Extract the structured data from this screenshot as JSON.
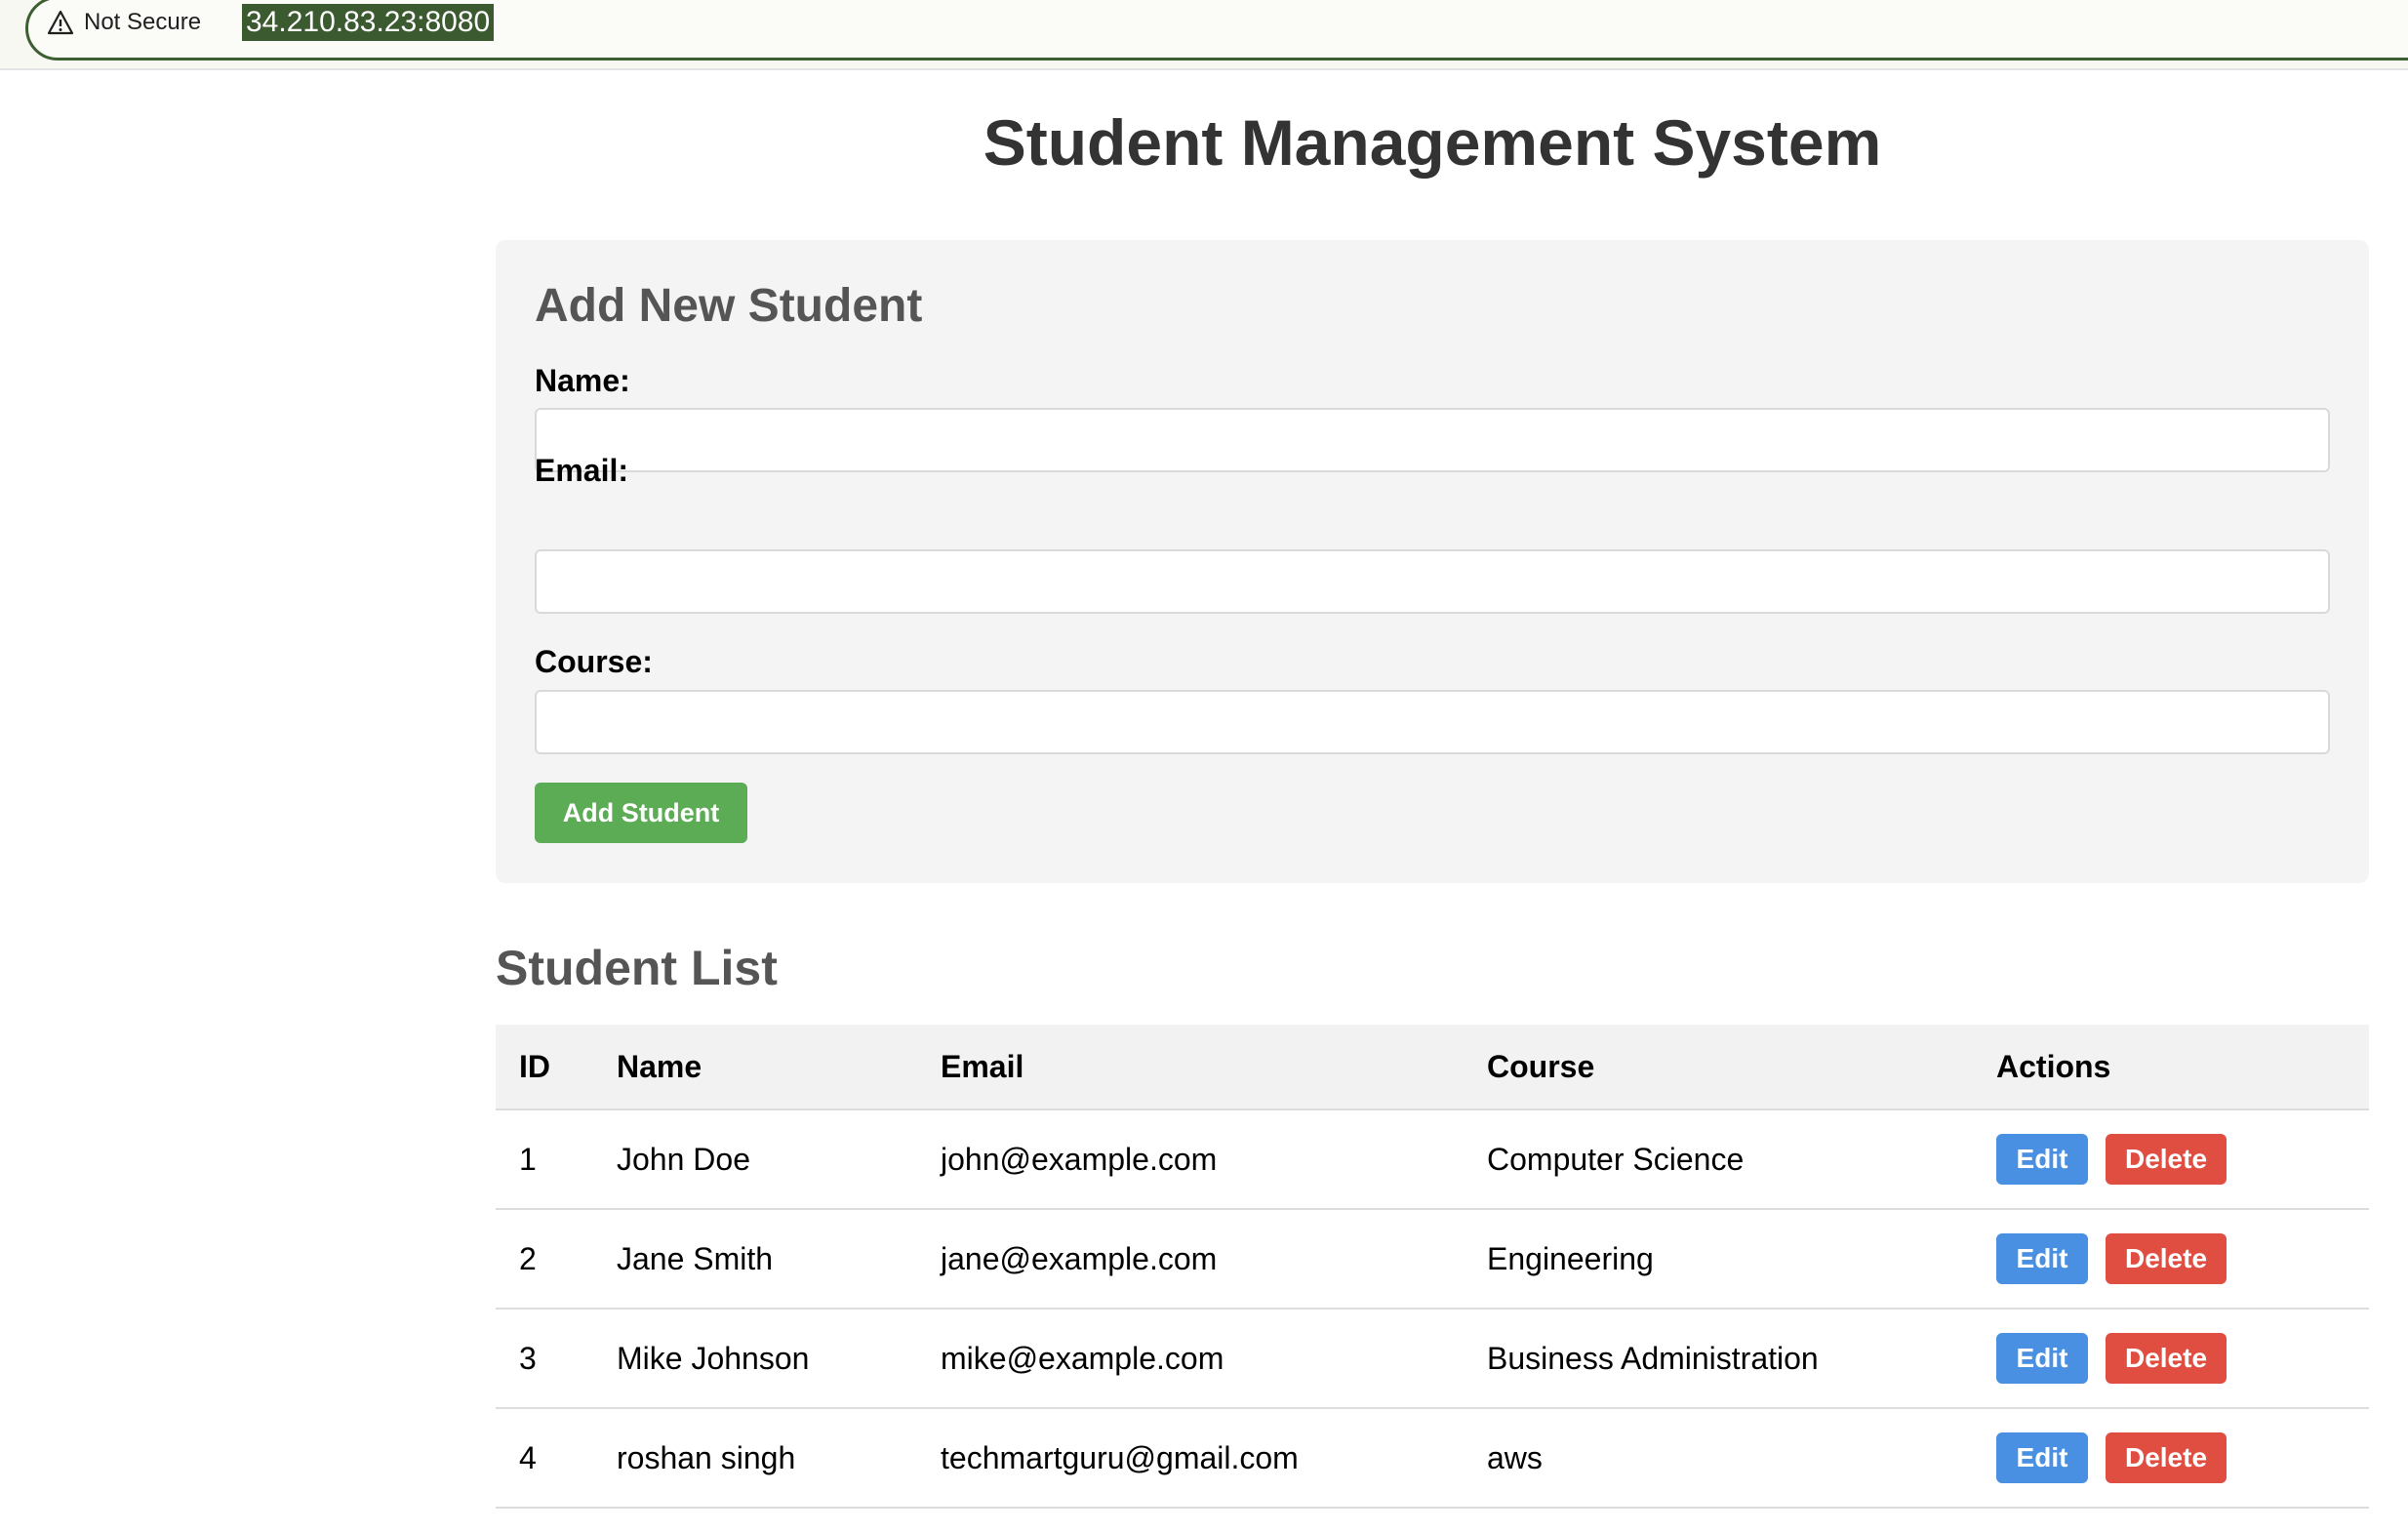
{
  "browser": {
    "security_label": "Not Secure",
    "url": "34.210.83.23:8080"
  },
  "page": {
    "title": "Student Management System"
  },
  "form": {
    "heading": "Add New Student",
    "name_label": "Name:",
    "name_value": "",
    "email_label": "Email:",
    "email_value": "",
    "course_label": "Course:",
    "course_value": "",
    "submit_label": "Add Student"
  },
  "list": {
    "heading": "Student List",
    "columns": [
      "ID",
      "Name",
      "Email",
      "Course",
      "Actions"
    ],
    "rows": [
      {
        "id": "1",
        "name": "John Doe",
        "email": "john@example.com",
        "course": "Computer Science"
      },
      {
        "id": "2",
        "name": "Jane Smith",
        "email": "jane@example.com",
        "course": "Engineering"
      },
      {
        "id": "3",
        "name": "Mike Johnson",
        "email": "mike@example.com",
        "course": "Business Administration"
      },
      {
        "id": "4",
        "name": "roshan singh",
        "email": "techmartguru@gmail.com",
        "course": "aws"
      }
    ],
    "edit_label": "Edit",
    "delete_label": "Delete"
  },
  "colors": {
    "primary_button": "#5cab55",
    "edit_button": "#4a90e2",
    "delete_button": "#e04e42"
  }
}
